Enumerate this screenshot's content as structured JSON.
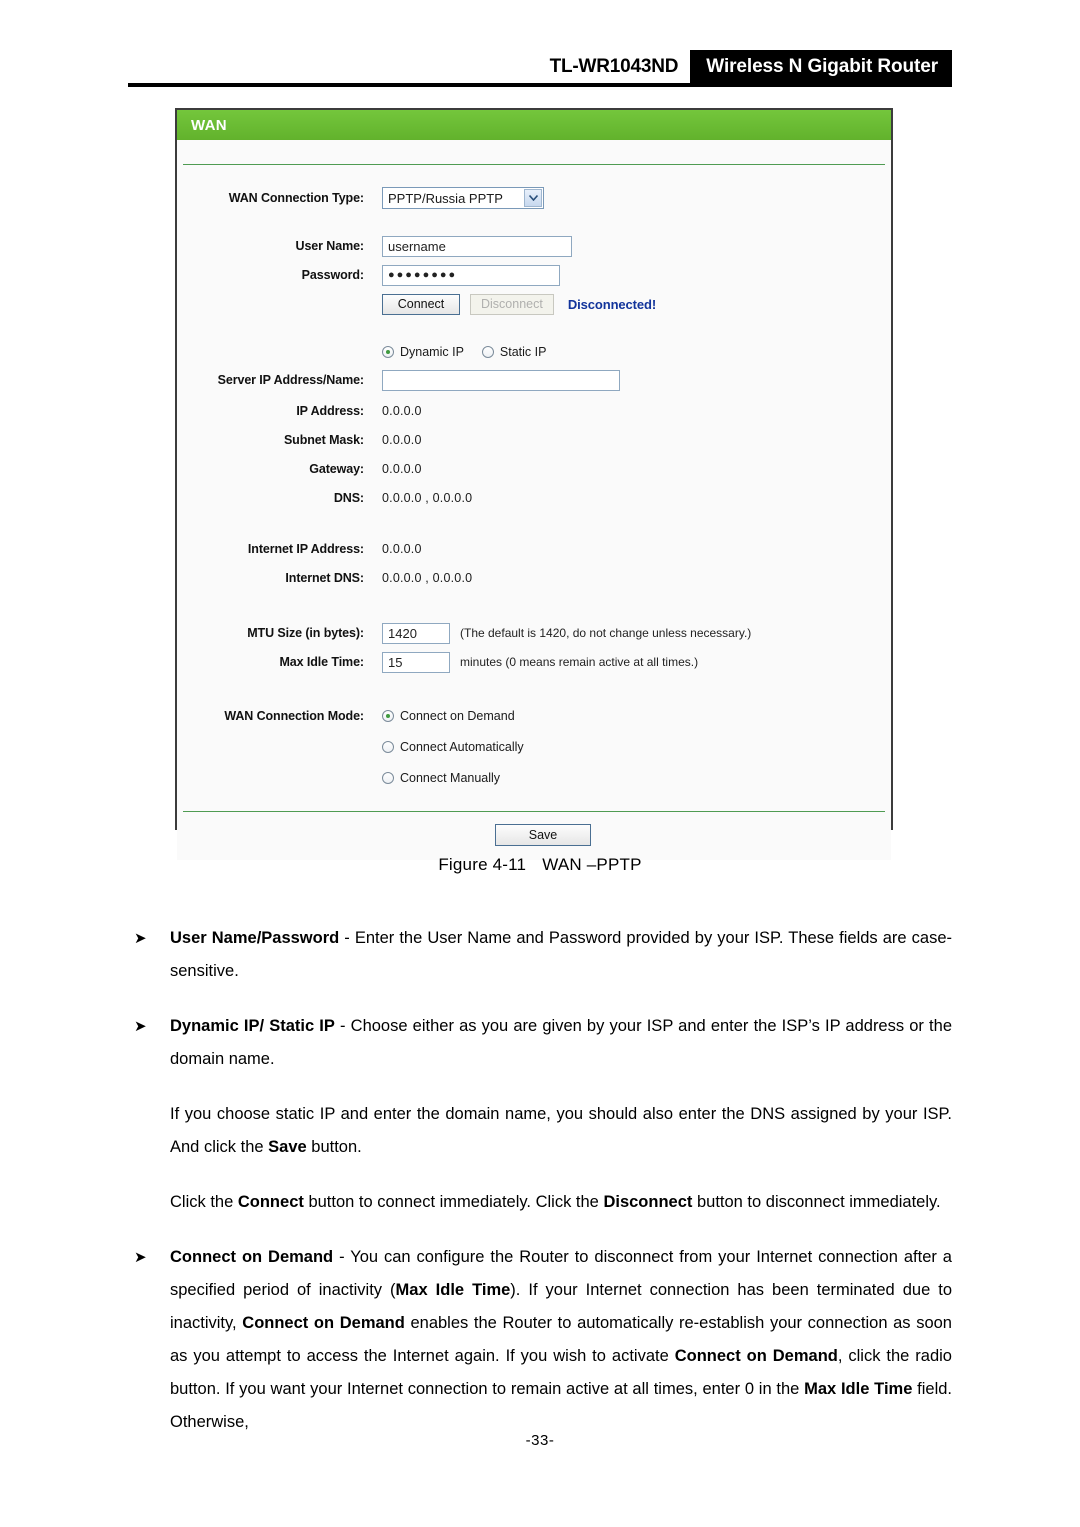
{
  "header": {
    "model": "TL-WR1043ND",
    "product": "Wireless N Gigabit Router"
  },
  "panel": {
    "title": "WAN",
    "fields": {
      "wan_connection_type_label": "WAN Connection Type:",
      "wan_connection_type_value": "PPTP/Russia PPTP",
      "user_name_label": "User Name:",
      "user_name_value": "username",
      "password_label": "Password:",
      "password_value": "●●●●●●●●",
      "connect_button": "Connect",
      "disconnect_button": "Disconnect",
      "connection_status": "Disconnected!",
      "dynamic_ip_label": "Dynamic IP",
      "static_ip_label": "Static IP",
      "server_ip_label": "Server IP Address/Name:",
      "server_ip_value": "",
      "ip_address_label": "IP Address:",
      "ip_address_value": "0.0.0.0",
      "subnet_mask_label": "Subnet Mask:",
      "subnet_mask_value": "0.0.0.0",
      "gateway_label": "Gateway:",
      "gateway_value": "0.0.0.0",
      "dns_label": "DNS:",
      "dns_value": "0.0.0.0 , 0.0.0.0",
      "internet_ip_label": "Internet IP Address:",
      "internet_ip_value": "0.0.0.0",
      "internet_dns_label": "Internet DNS:",
      "internet_dns_value": "0.0.0.0 , 0.0.0.0",
      "mtu_label": "MTU Size (in bytes):",
      "mtu_value": "1420",
      "mtu_hint": "(The default is 1420, do not change unless necessary.)",
      "max_idle_label": "Max Idle Time:",
      "max_idle_value": "15",
      "max_idle_hint": "minutes (0 means remain active at all times.)",
      "wan_mode_label": "WAN Connection Mode:",
      "mode_on_demand": "Connect on Demand",
      "mode_automatically": "Connect Automatically",
      "mode_manually": "Connect Manually",
      "save_button": "Save"
    }
  },
  "caption": {
    "figure": "Figure 4-11",
    "title": "WAN –PPTP"
  },
  "body": {
    "b1_term": "User Name/Password",
    "b1_text": " - Enter the User Name and Password provided by your ISP. These fields are case-sensitive.",
    "b2_term": "Dynamic IP/ Static IP",
    "b2_text": " - Choose either as you are given by your ISP and enter the ISP’s IP address or the domain name.",
    "p1_a": "If you choose static IP and enter the domain name, you should also enter the DNS assigned by your ISP. And click the ",
    "p1_b": "Save",
    "p1_c": " button.",
    "p2_a": "Click the ",
    "p2_b": "Connect",
    "p2_c": " button to connect immediately. Click the ",
    "p2_d": "Disconnect",
    "p2_e": " button to disconnect immediately.",
    "b3_term": "Connect on Demand",
    "b3_a": " - You can configure the Router to disconnect from your Internet connection after a specified period of inactivity (",
    "b3_b": "Max Idle Time",
    "b3_c": "). If your Internet connection has been terminated due to inactivity, ",
    "b3_d": "Connect on Demand",
    "b3_e": " enables the Router to automatically re-establish your connection as soon as you attempt to access the Internet again. If you wish to activate ",
    "b3_f": "Connect on Demand",
    "b3_g": ", click the radio button. If you want your Internet connection to remain active at all times, enter 0 in the ",
    "b3_h": "Max Idle Time",
    "b3_i": " field. Otherwise,"
  },
  "footer": {
    "page_number": "-33-"
  },
  "icons": {
    "bullet_marker": "➤",
    "chevron_down": "chevron-down-icon"
  },
  "colors": {
    "panel_green": "#6cbe33",
    "status_blue": "#12349b",
    "header_black": "#000000"
  }
}
